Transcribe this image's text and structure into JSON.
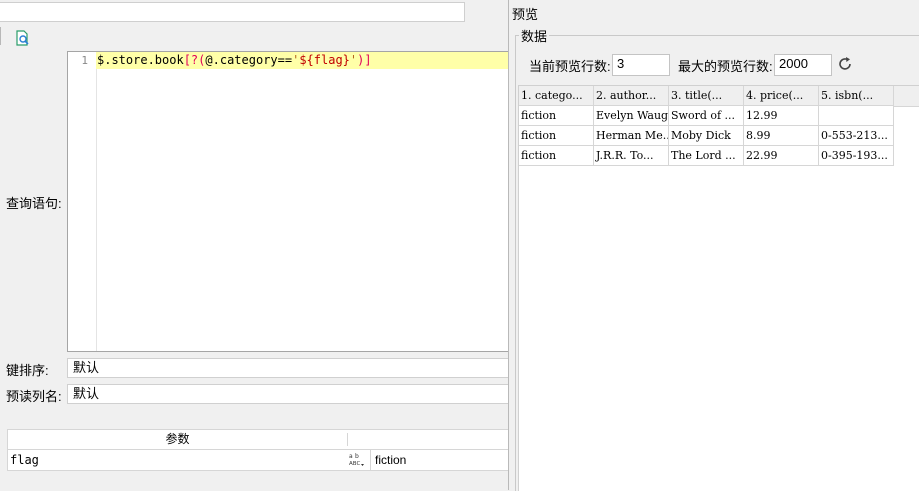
{
  "editor": {
    "line_number": "1",
    "code": {
      "prefix": "$.store.book",
      "open": "[?(",
      "mid": "@.category==",
      "str_open": "'",
      "var": "${flag}",
      "str_close": "'",
      "close": ")]"
    }
  },
  "labels": {
    "query": "查询语句:",
    "key_sort": "键排序:",
    "preread_cols": "预读列名:"
  },
  "fields": {
    "key_sort_value": "默认",
    "preread_cols_value": "默认"
  },
  "params": {
    "header": "参数",
    "rows": [
      {
        "name": "flag",
        "value": "fiction",
        "type_icon": "abc-type-icon"
      }
    ]
  },
  "preview": {
    "title": "预览",
    "group_title": "数据",
    "current_rows_label": "当前预览行数:",
    "current_rows_value": "3",
    "max_rows_label": "最大的预览行数:",
    "max_rows_value": "2000",
    "refresh_icon": "refresh-icon",
    "columns": [
      "1. catego...",
      "2. author...",
      "3. title(...",
      "4. price(...",
      "5. isbn(..."
    ],
    "rows": [
      [
        "fiction",
        "Evelyn Waugh",
        "Sword of ...",
        "12.99",
        ""
      ],
      [
        "fiction",
        "Herman Me...",
        "Moby Dick",
        "8.99",
        "0-553-213..."
      ],
      [
        "fiction",
        "J.R.R.  To...",
        "The Lord ...",
        "22.99",
        "0-395-193..."
      ]
    ]
  }
}
